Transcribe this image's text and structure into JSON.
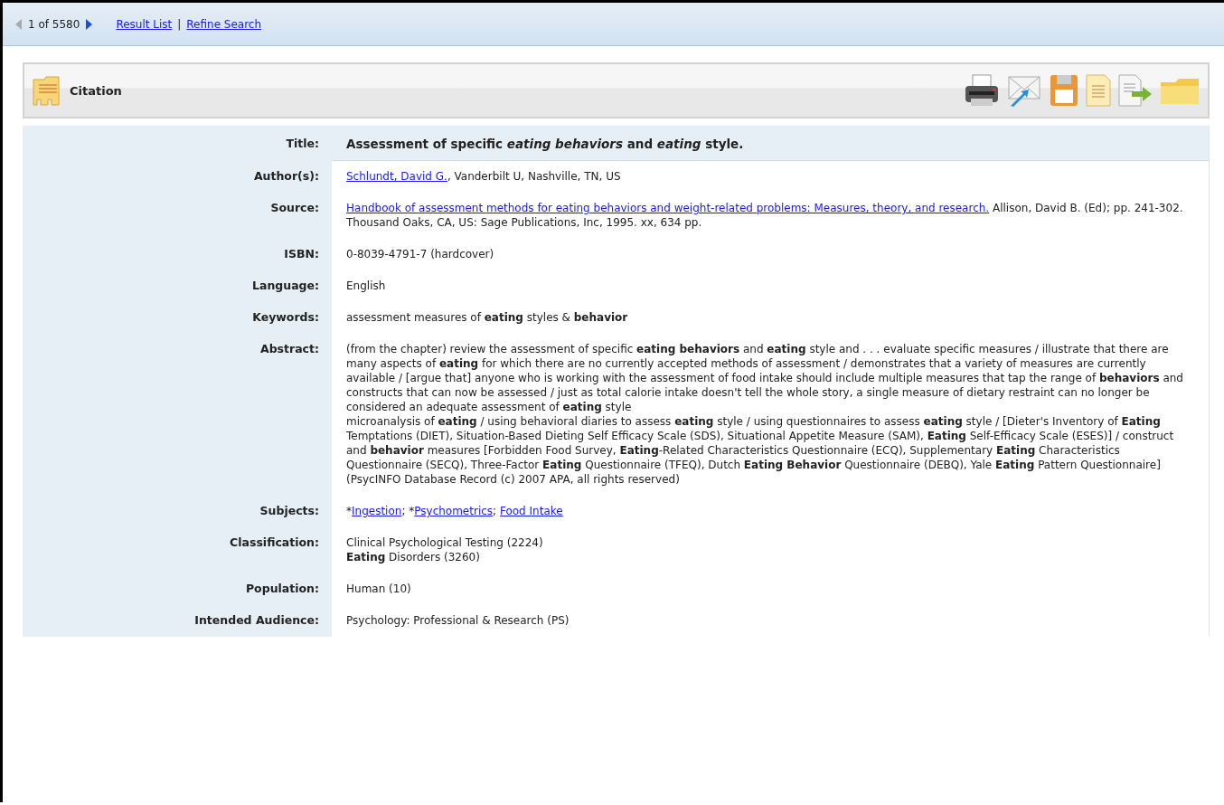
{
  "nav": {
    "position": "1 of 5580",
    "previous_disabled": true,
    "next_disabled": false,
    "links": [
      "Result List",
      "Refine Search"
    ],
    "separator": "|"
  },
  "panel": {
    "title": "Citation"
  },
  "fields": [
    {
      "label": "Title:",
      "highlight": true,
      "lines": [
        [
          {
            "kind": "text",
            "text": "Assessment of specific *eating behaviors* and *eating* style."
          }
        ]
      ]
    },
    {
      "label": "Author(s):",
      "highlight": false,
      "lines": [
        [
          {
            "kind": "link",
            "text": "Schlundt, David G."
          },
          {
            "kind": "text",
            "text": ", Vanderbilt U, Nashville, TN, US"
          }
        ]
      ]
    },
    {
      "label": "Source:",
      "highlight": false,
      "lines": [
        [
          {
            "kind": "link",
            "text": "Handbook of assessment methods for eating behaviors and weight-related problems: Measures, theory, and research."
          },
          {
            "kind": "text",
            "text": " Allison, David B. (Ed); pp. 241-302. Thousand Oaks, CA, US: Sage Publications, Inc, 1995. xx, 634 pp."
          }
        ]
      ]
    },
    {
      "label": "ISBN:",
      "highlight": false,
      "lines": [
        [
          {
            "kind": "text",
            "text": "0-8039-4791-7 (hardcover)"
          }
        ]
      ]
    },
    {
      "label": "Language:",
      "highlight": false,
      "lines": [
        [
          {
            "kind": "text",
            "text": "English"
          }
        ]
      ]
    },
    {
      "label": "Keywords:",
      "highlight": false,
      "lines": [
        [
          {
            "kind": "text",
            "text": "assessment measures of **eating** styles & **behavior**"
          }
        ]
      ]
    },
    {
      "label": "Abstract:",
      "highlight": false,
      "lines": [
        [
          {
            "kind": "text",
            "text": "(from the chapter) review the assessment of specific **eating behaviors** and **eating** style and . . . evaluate specific measures / illustrate that there are many aspects of **eating** for which there are no currently accepted methods of assessment / demonstrates that a variety of measures are currently available / [argue that] anyone who is working with the assessment of food intake should include multiple measures that tap the range of **behaviors** and constructs that can now be assessed / just as total calorie intake doesn't tell the whole story, a single measure of dietary restraint can no longer be considered an adequate assessment of **eating** style"
          }
        ],
        [
          {
            "kind": "text",
            "text": "microanalysis of **eating** / using behavioral diaries to assess **eating** style / using questionnaires to assess **eating** style / [Dieter's Inventory of **Eating** Temptations (DIET), Situation-Based Dieting Self Efficacy Scale (SDS), Situational Appetite Measure (SAM), **Eating** Self-Efficacy Scale (ESES)] / construct and **behavior** measures [Forbidden Food Survey, **Eating**-Related Characteristics Questionnaire (ECQ), Supplementary **Eating** Characteristics Questionnaire (SECQ), Three-Factor **Eating** Questionnaire (TFEQ), Dutch **Eating Behavior** Questionnaire (DEBQ), Yale **Eating** Pattern Questionnaire] (PsycINFO Database Record (c) 2007 APA, all rights reserved)"
          }
        ]
      ]
    },
    {
      "label": "Subjects:",
      "highlight": false,
      "lines": [
        [
          {
            "kind": "text",
            "text": "*"
          },
          {
            "kind": "link",
            "text": "Ingestion"
          },
          {
            "kind": "text",
            "text": "; *"
          },
          {
            "kind": "link",
            "text": "Psychometrics"
          },
          {
            "kind": "text",
            "text": "; "
          },
          {
            "kind": "link",
            "text": "Food Intake"
          }
        ]
      ]
    },
    {
      "label": "Classification:",
      "highlight": false,
      "lines": [
        [
          {
            "kind": "text",
            "text": "Clinical Psychological Testing (2224)"
          }
        ],
        [
          {
            "kind": "text",
            "text": "**Eating** Disorders (3260)"
          }
        ]
      ]
    },
    {
      "label": "Population:",
      "highlight": false,
      "lines": [
        [
          {
            "kind": "text",
            "text": "Human (10)"
          }
        ]
      ]
    },
    {
      "label": "Intended Audience:",
      "highlight": false,
      "lines": [
        [
          {
            "kind": "text",
            "text": "Psychology: Professional & Research (PS)"
          }
        ]
      ]
    }
  ]
}
